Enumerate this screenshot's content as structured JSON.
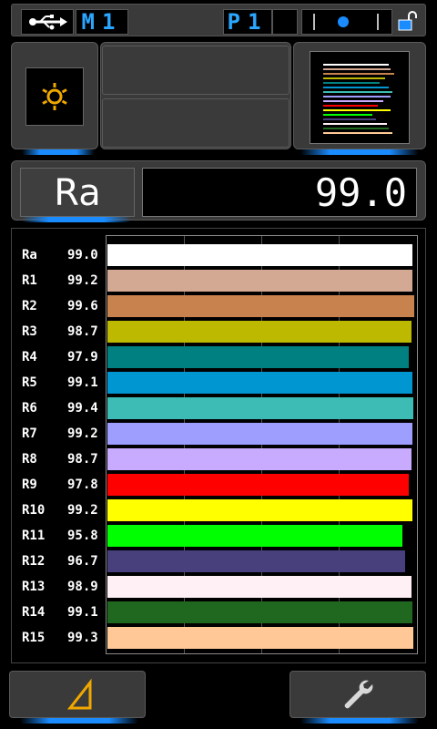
{
  "status": {
    "usb_icon": "usb-icon",
    "mode": "M1",
    "program": "P1",
    "lock_icon": "unlock-icon",
    "level_icon": "level-indicator"
  },
  "light_icon": "light-source-icon",
  "thumbnail": {
    "icon": "cri-list-thumbnail",
    "lines": [
      "#ffffff",
      "#d4a993",
      "#c8824e",
      "#bdb800",
      "#008080",
      "#0096d2",
      "#3cbcb4",
      "#9e9eff",
      "#c8aaff",
      "#ff0000",
      "#ffff00",
      "#00ff00",
      "#48407c",
      "#fff0f5",
      "#206820",
      "#ffc896"
    ]
  },
  "ra": {
    "label": "Ra",
    "value": "99.0"
  },
  "chart_data": {
    "type": "bar",
    "orientation": "horizontal",
    "categories": [
      "Ra",
      "R1",
      "R2",
      "R3",
      "R4",
      "R5",
      "R6",
      "R7",
      "R8",
      "R9",
      "R10",
      "R11",
      "R12",
      "R13",
      "R14",
      "R15"
    ],
    "values": [
      99.0,
      99.2,
      99.6,
      98.7,
      97.9,
      99.1,
      99.4,
      99.2,
      98.7,
      97.8,
      99.2,
      95.8,
      96.7,
      98.9,
      99.1,
      99.3
    ],
    "value_labels": [
      "99.0",
      "99.2",
      "99.6",
      "98.7",
      "97.9",
      "99.1",
      "99.4",
      "99.2",
      "98.7",
      "97.8",
      "99.2",
      "95.8",
      "96.7",
      "98.9",
      "99.1",
      "99.3"
    ],
    "colors": [
      "#ffffff",
      "#d4a993",
      "#c8824e",
      "#bdb800",
      "#008080",
      "#0096d2",
      "#3cbcb4",
      "#9e9eff",
      "#c8aaff",
      "#ff0000",
      "#ffff00",
      "#00ff00",
      "#48407c",
      "#fff0f5",
      "#206820",
      "#ffc896"
    ],
    "xlim": [
      0,
      100
    ],
    "grid": true
  },
  "buttons": {
    "left_icon": "triangle-icon",
    "right_icon": "wrench-icon"
  }
}
